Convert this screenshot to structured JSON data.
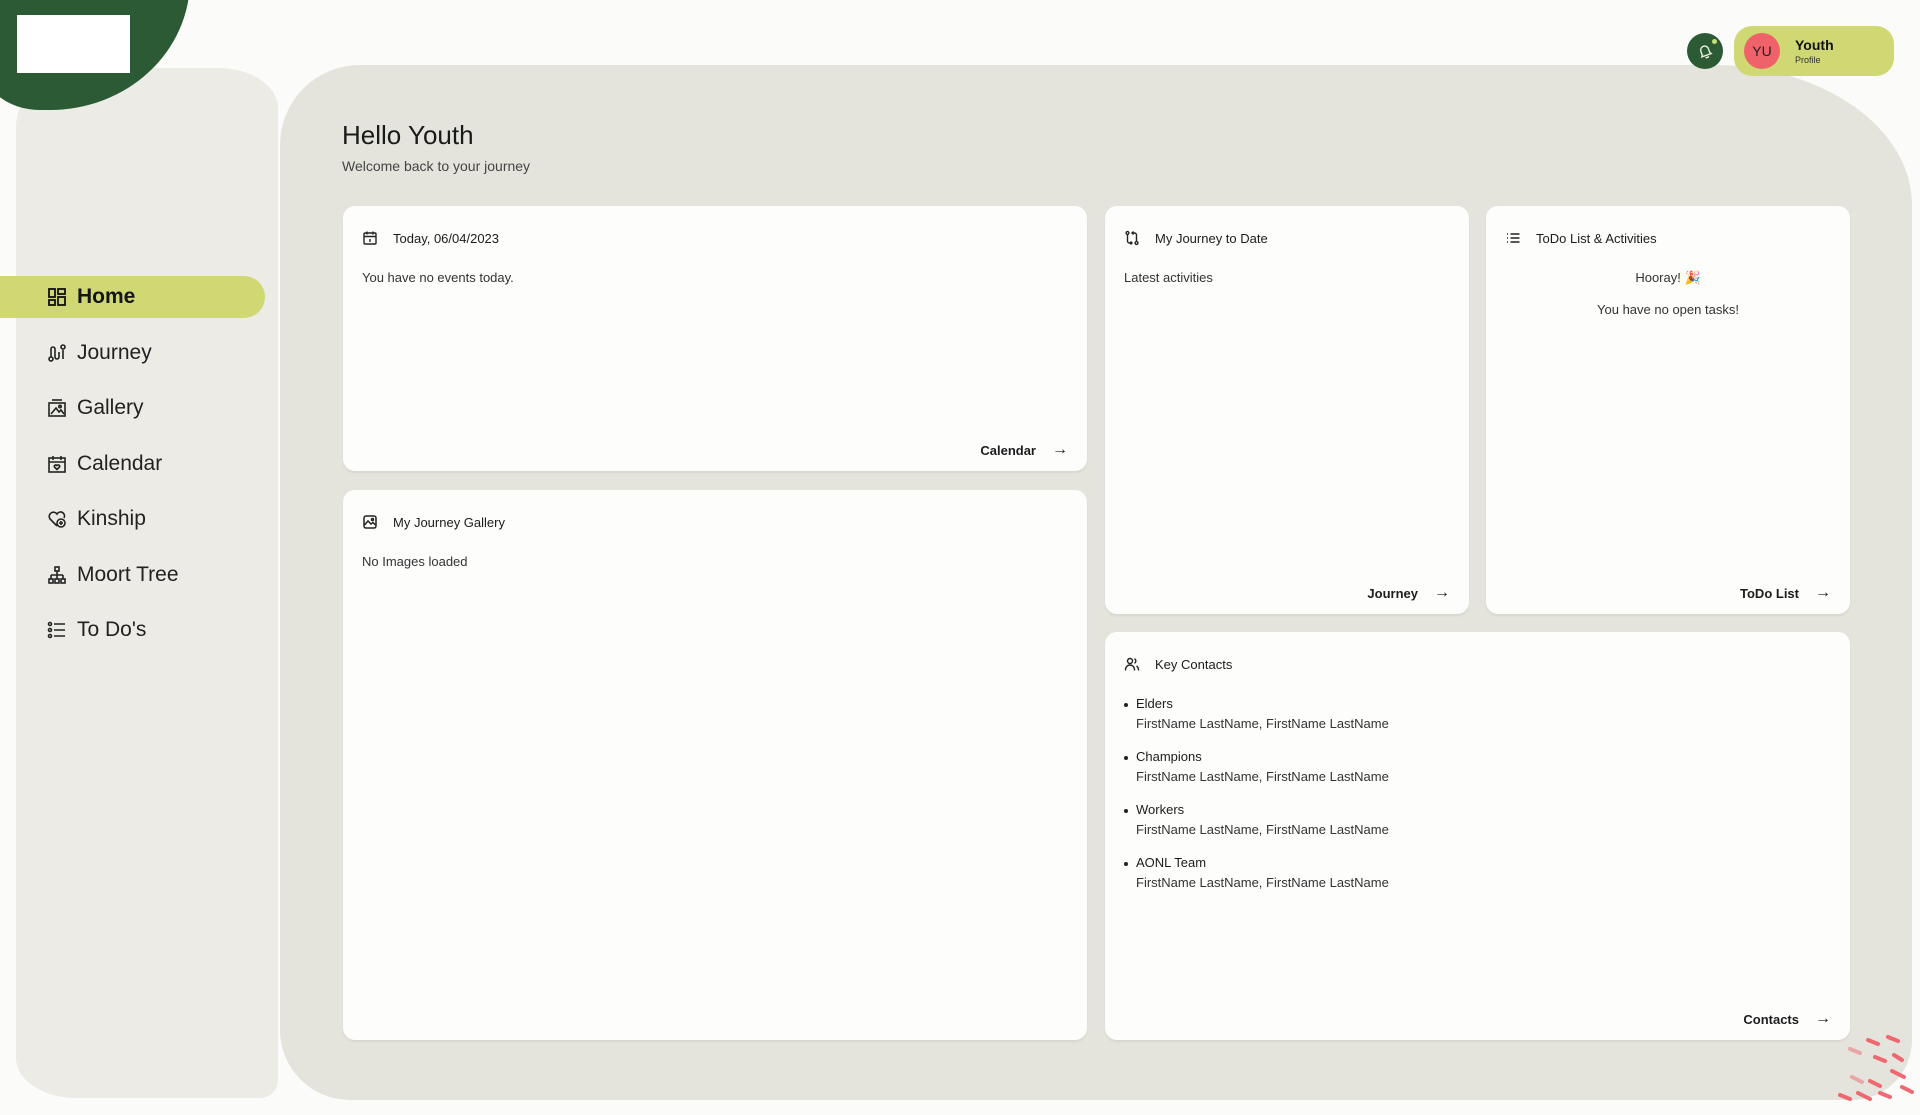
{
  "brand": {
    "logo_alt": "",
    "colors": {
      "brand_green": "#2c5a35",
      "accent_lime": "#cfd873",
      "avatar_red": "#f0626a",
      "main_bg": "#e4e4dc",
      "sidebar_bg": "#ecebe6",
      "card_bg": "#fdfdfc"
    }
  },
  "header": {
    "notification_icon": "bell-icon",
    "notification_has_unread": true,
    "profile": {
      "initials": "YU",
      "name": "Youth",
      "subtitle": "Profile"
    }
  },
  "sidebar": {
    "items": [
      {
        "label": "Home",
        "icon": "dashboard-grid-icon",
        "active": true
      },
      {
        "label": "Journey",
        "icon": "route-icon",
        "active": false
      },
      {
        "label": "Gallery",
        "icon": "image-gallery-icon",
        "active": false
      },
      {
        "label": "Calendar",
        "icon": "calendar-heart-icon",
        "active": false
      },
      {
        "label": "Kinship",
        "icon": "heart-plus-icon",
        "active": false
      },
      {
        "label": "Moort Tree",
        "icon": "hierarchy-icon",
        "active": false
      },
      {
        "label": "To Do's",
        "icon": "list-icon",
        "active": false
      }
    ]
  },
  "greeting": {
    "title": "Hello Youth",
    "subtitle": "Welcome back to your journey"
  },
  "cards": {
    "calendar": {
      "title": "Today, 06/04/2023",
      "icon": "calendar-icon",
      "body": "You have no events today.",
      "link": "Calendar"
    },
    "gallery": {
      "title": "My Journey Gallery",
      "icon": "image-icon",
      "body": "No Images loaded"
    },
    "journey": {
      "title": "My Journey to Date",
      "icon": "git-compare-icon",
      "body": "Latest activities",
      "link": "Journey"
    },
    "todo": {
      "title": "ToDo List & Activities",
      "icon": "list-icon",
      "line1": "Hooray! 🎉",
      "line2": "You have no open tasks!",
      "link": "ToDo List"
    },
    "contacts": {
      "title": "Key Contacts",
      "icon": "users-icon",
      "groups": [
        {
          "role": "Elders",
          "names": "FirstName LastName, FirstName LastName"
        },
        {
          "role": "Champions",
          "names": "FirstName LastName, FirstName LastName"
        },
        {
          "role": "Workers",
          "names": "FirstName LastName, FirstName LastName"
        },
        {
          "role": "AONL Team",
          "names": "FirstName LastName, FirstName LastName"
        }
      ],
      "link": "Contacts"
    }
  },
  "arrow_glyph": "→"
}
